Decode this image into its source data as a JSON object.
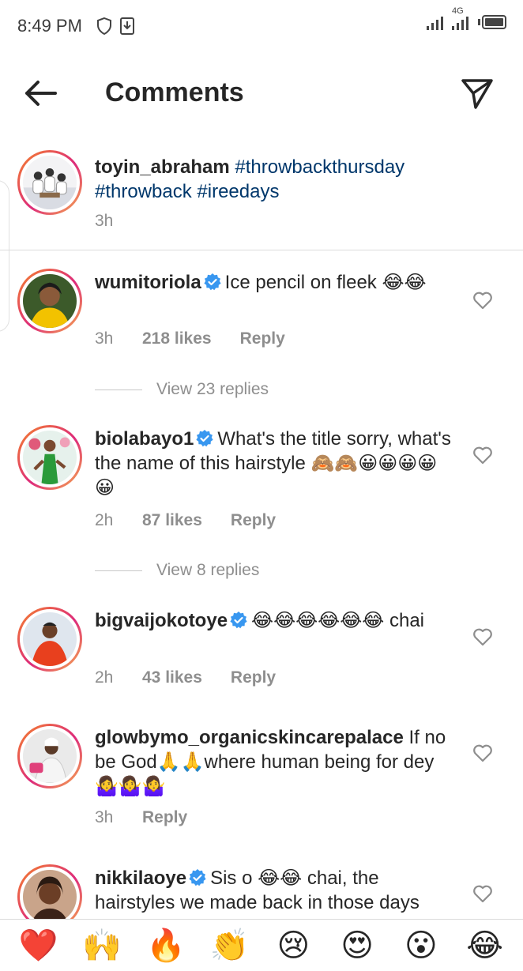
{
  "status_bar": {
    "time": "8:49 PM",
    "network": "4G"
  },
  "header": {
    "title": "Comments"
  },
  "caption": {
    "username": "toyin_abraham",
    "text": "#throwbackthursday #throwback #ireedays",
    "time": "3h"
  },
  "comments": [
    {
      "username": "wumitoriola",
      "verified": true,
      "text": "Ice pencil on fleek 😂😂",
      "time": "3h",
      "likes": "218 likes",
      "reply": "Reply",
      "view_replies": "View 23 replies"
    },
    {
      "username": "biolabayo1",
      "verified": true,
      "text": "What's the title sorry, what's the name of this hairstyle 🙈🙈😀😀😀😀😀",
      "time": "2h",
      "likes": "87 likes",
      "reply": "Reply",
      "view_replies": "View 8 replies"
    },
    {
      "username": "bigvaijokotoye",
      "verified": true,
      "text": "😂😂😂😂😂😂 chai",
      "time": "2h",
      "likes": "43 likes",
      "reply": "Reply"
    },
    {
      "username": "glowbymo_organicskincarepalace",
      "verified": false,
      "text": "If no be God🙏🙏where human being for dey 🤷‍♀️🤷‍♀️🤷‍♀️",
      "time": "3h",
      "reply": "Reply"
    },
    {
      "username": "nikkilaoye",
      "verified": true,
      "text": "Sis o 😂😂 chai, the hairstyles we made back in those days",
      "time": "",
      "reply": ""
    }
  ],
  "reactions": [
    "❤️",
    "🙌",
    "🔥",
    "👏",
    "😢",
    "😍",
    "😮",
    "😂"
  ],
  "colors": {
    "hashtag": "#00376b",
    "verified": "#3897f0",
    "secondary_text": "#8e8e8e"
  }
}
